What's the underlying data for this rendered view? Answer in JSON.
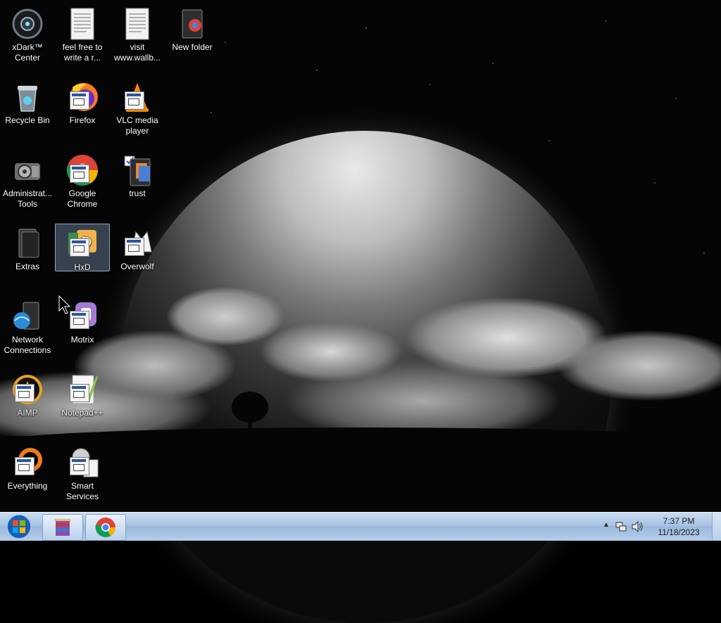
{
  "desktop": {
    "icons": [
      {
        "label": "xDark™ Center",
        "icon": "xdark-icon"
      },
      {
        "label": "feel free to write a r...",
        "icon": "text-document-icon"
      },
      {
        "label": "visit www.wallb...",
        "icon": "text-document-icon"
      },
      {
        "label": "New folder",
        "icon": "folder-icon"
      },
      {
        "label": "Recycle Bin",
        "icon": "recycle-bin-icon"
      },
      {
        "label": "Firefox",
        "icon": "firefox-icon"
      },
      {
        "label": "VLC media player",
        "icon": "vlc-icon"
      },
      {
        "label": "Administrat... Tools",
        "icon": "admin-tools-icon"
      },
      {
        "label": "Google Chrome",
        "icon": "chrome-icon"
      },
      {
        "label": "trust",
        "icon": "folder-icon"
      },
      {
        "label": "Extras",
        "icon": "folder-icon"
      },
      {
        "label": "HxD",
        "icon": "hxd-icon"
      },
      {
        "label": "Overwolf",
        "icon": "overwolf-icon"
      },
      {
        "label": "Network Connections",
        "icon": "network-connections-icon"
      },
      {
        "label": "Motrix",
        "icon": "motrix-icon"
      },
      {
        "label": "AIMP",
        "icon": "aimp-icon"
      },
      {
        "label": "Notepad++",
        "icon": "notepad-plus-plus-icon"
      },
      {
        "label": "Everything",
        "icon": "everything-search-icon"
      },
      {
        "label": "Smart Services",
        "icon": "smart-services-icon"
      }
    ],
    "selected": "HxD"
  },
  "taskbar": {
    "pinned": [
      {
        "name": "winrar-icon"
      },
      {
        "name": "chrome-icon"
      }
    ],
    "clock": {
      "time": "7:37 PM",
      "date": "11/18/2023"
    }
  },
  "colors": {
    "taskbar": "#a8c4e4",
    "selection": "#96b4dc"
  }
}
